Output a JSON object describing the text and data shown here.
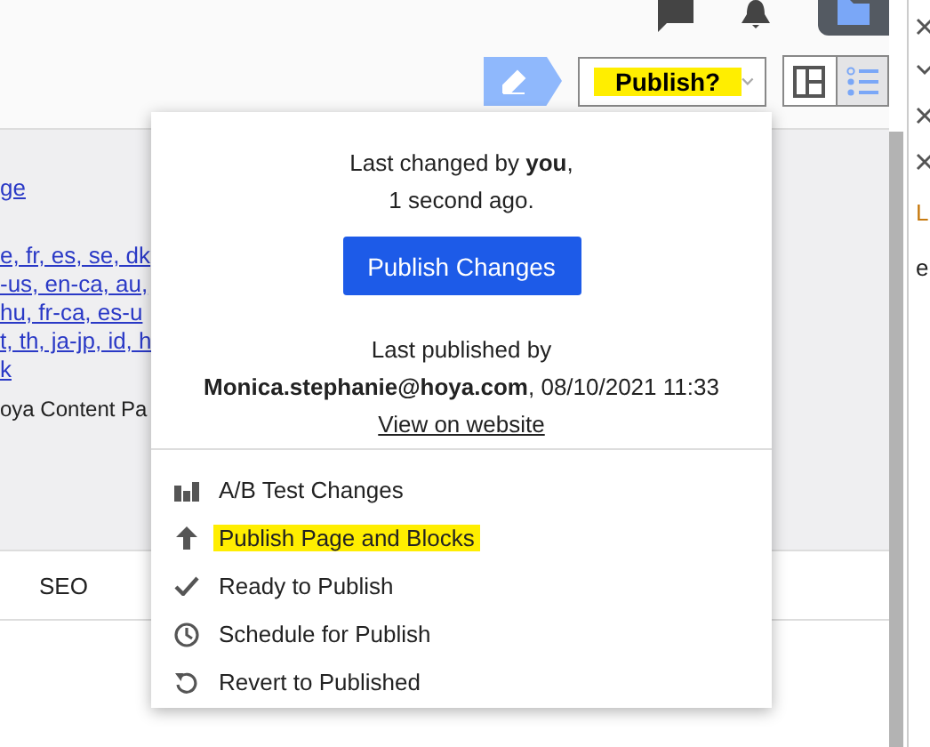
{
  "toolbar": {
    "publish_dropdown": {
      "label": "Publish?",
      "highlighted": true
    },
    "view_modes": [
      {
        "kind": "columns",
        "selected": false
      },
      {
        "kind": "list",
        "selected": true
      }
    ]
  },
  "page_content": {
    "link": "ge",
    "language_links": [
      "e, fr, es, se, dk",
      "-us, en-ca, au,",
      "hu, fr-ca, es-u",
      "t, th, ja-jp, id, h",
      "k"
    ],
    "text": "oya Content Pa",
    "tab": "SEO"
  },
  "publish_menu": {
    "last_changed": "Last changed by **you**,",
    "changed_ago": "1 second ago.",
    "publish_button": "Publish Changes",
    "last_published_label": "Last published by",
    "last_published_by": "**Monica.stephanie@hoya.com**, 08/10/2021 11:33",
    "view_link": "View on website",
    "items": [
      {
        "kind": "ab-test",
        "label": "A/B Test Changes",
        "highlighted": false
      },
      {
        "kind": "publish",
        "label": "Publish Page and Blocks",
        "highlighted": true
      },
      {
        "kind": "ready",
        "label": "Ready to Publish",
        "highlighted": false
      },
      {
        "kind": "schedule",
        "label": "Schedule for Publish",
        "highlighted": false
      },
      {
        "kind": "revert",
        "label": "Revert to Published",
        "highlighted": false
      }
    ]
  },
  "side_panel": {
    "texts": [
      "L",
      "e"
    ]
  }
}
